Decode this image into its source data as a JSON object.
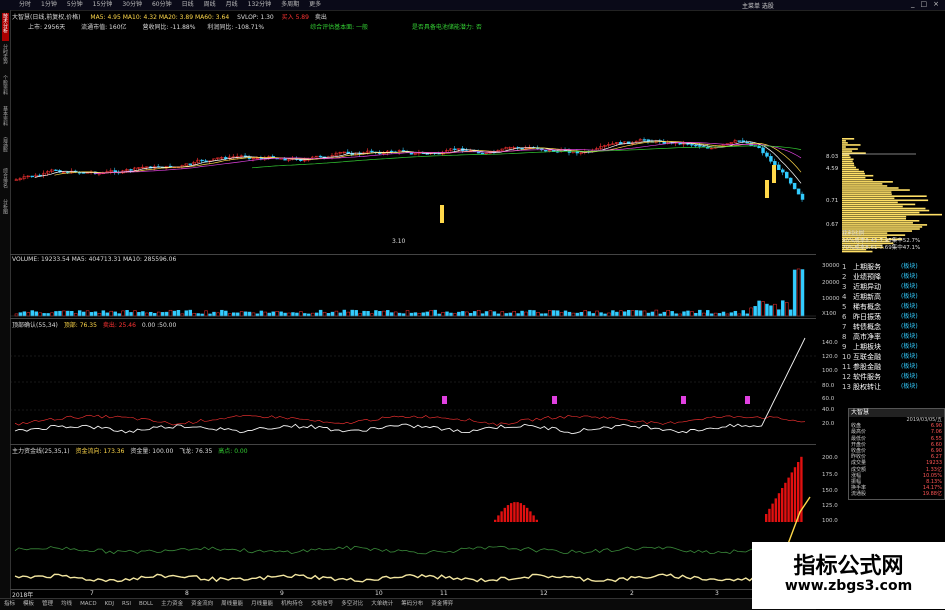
{
  "menu": [
    "分时",
    "1分钟",
    "5分钟",
    "15分钟",
    "30分钟",
    "60分钟",
    "日线",
    "周线",
    "月线",
    "132分钟",
    "多周期",
    "更多"
  ],
  "window_title": "主菜单 选股",
  "window_controls": [
    "_",
    "□",
    "×"
  ],
  "left_tabs": [
    "技术分析",
    "分时走势",
    "个股资料",
    "基本资料",
    "自选股",
    "综合排名",
    "分析图"
  ],
  "header": {
    "line1_title": "大智慧(日线,前复权,价格)",
    "line1_ma": "MA5: 4.95  MA10: 4.32  MA20: 3.89  MA60: 3.64",
    "line1_extra": "SVLOP: 1.30",
    "line1_right": "买入 5.89",
    "line1_right2": "卖出",
    "line2_left": "上市: 2956天",
    "line2_mid": "流通市值: 160亿",
    "line2_rev": "营收同比: -11.88%",
    "line2_profit": "利润同比: -108.71%",
    "line2_tag1": "综合评估基本面: 一般",
    "line2_tag2": "是否具备电池储能潜力: 否"
  },
  "price_panel": {
    "low_label": "3.10",
    "right_axis": [
      "8.03",
      "4.59",
      "0.71",
      "0.67"
    ],
    "vol_profile_lines": [
      "获利比例",
      "90%成本8.42-7.95集中52.7%",
      "70%成本8.61-7.69集中47.1%"
    ]
  },
  "volume_panel": {
    "title": "VOLUME: 19233.54  MA5: 404713.31  MA10: 285596.06",
    "axis": [
      "30000",
      "20000",
      "10000",
      "X100"
    ]
  },
  "osc_panel": {
    "title": "顶部确认(55,34)",
    "value1": "顶部: 76.35",
    "value2": "卖出: 25.46",
    "value3": "0.00  :50.00",
    "axis": [
      "140.0",
      "120.0",
      "100.0",
      "80.0",
      "60.0",
      "40.0",
      "20.0"
    ]
  },
  "main_force_panel": {
    "title": "主力资金线(25,35,1)",
    "value1": "资金流向: 173.36",
    "value2": "资金量: 100.00",
    "value3": "飞龙: 76.35",
    "value4": "高点: 0.00",
    "axis": [
      "200.0",
      "175.0",
      "150.0",
      "125.0",
      "100.0"
    ]
  },
  "x_axis": [
    "2018年",
    "7",
    "8",
    "9",
    "10",
    "11",
    "12",
    "2",
    "3"
  ],
  "blocks": [
    {
      "n": "1",
      "name": "上期服务",
      "tag": "(板块)"
    },
    {
      "n": "2",
      "name": "业绩预降",
      "tag": "(板块)"
    },
    {
      "n": "3",
      "name": "近期异动",
      "tag": "(板块)"
    },
    {
      "n": "4",
      "name": "近期新高",
      "tag": "(板块)"
    },
    {
      "n": "5",
      "name": "稀有概念",
      "tag": "(板块)"
    },
    {
      "n": "6",
      "name": "昨日振荡",
      "tag": "(板块)"
    },
    {
      "n": "7",
      "name": "转债概念",
      "tag": "(板块)"
    },
    {
      "n": "8",
      "name": "高市净率",
      "tag": "(板块)"
    },
    {
      "n": "9",
      "name": "上期板块",
      "tag": "(板块)"
    },
    {
      "n": "10",
      "name": "互联金融",
      "tag": "(板块)"
    },
    {
      "n": "11",
      "name": "参股金融",
      "tag": "(板块)"
    },
    {
      "n": "12",
      "name": "软件服务",
      "tag": "(板块)"
    },
    {
      "n": "13",
      "name": "股权转让",
      "tag": "(板块)"
    }
  ],
  "stockbox": {
    "title": "大智慧",
    "date": "2019/03/05/五",
    "rows": [
      {
        "k": "收盘",
        "v": "6.90"
      },
      {
        "k": "最高价",
        "v": "7.06"
      },
      {
        "k": "最低价",
        "v": "6.55"
      },
      {
        "k": "开盘价",
        "v": "6.60"
      },
      {
        "k": "收盘价",
        "v": "6.90"
      },
      {
        "k": "昨收价",
        "v": "6.27"
      },
      {
        "k": "成交量",
        "v": "19233"
      },
      {
        "k": "成交额",
        "v": "1.33亿"
      },
      {
        "k": "涨幅",
        "v": "10.05%"
      },
      {
        "k": "振幅",
        "v": "8.13%"
      },
      {
        "k": "换手率",
        "v": "14.17%"
      },
      {
        "k": "流通股",
        "v": "19.88亿"
      }
    ]
  },
  "bottom_tabs": [
    "指标",
    "模板",
    "管理",
    "均线",
    "MACD",
    "KDJ",
    "RSI",
    "BOLL",
    "主力资金",
    "资金流向",
    "周线量能",
    "月线量能",
    "机构持仓",
    "交易信号",
    "多空对比",
    "大单统计",
    "筹码分布",
    "资金博弈"
  ],
  "watermark": {
    "line1": "指标公式网",
    "line2": "www.zbgs3.com"
  },
  "colors": {
    "up": "#ff3333",
    "down": "#33ccff",
    "ma5": "#ffffff",
    "ma10": "#ffd84a",
    "ma20": "#e040e0",
    "ma60": "#3c3"
  }
}
